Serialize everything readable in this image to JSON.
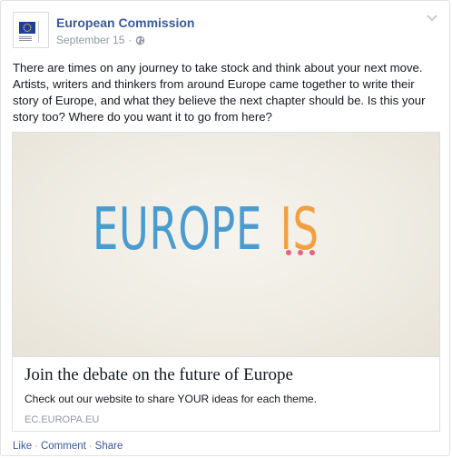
{
  "post": {
    "page_name": "European Commission",
    "date": "September 15",
    "meta_separator": "·",
    "privacy_icon": "globe-icon",
    "menu_icon": "chevron-down-icon",
    "text": "There are times on any journey to take stock and think about your next move. Artists, writers and thinkers from around Europe came together to write their story of Europe, and what they believe the next chapter should be. Is this your story too? Where do you want it to go from here?"
  },
  "card": {
    "image_text_main": "EUROPE",
    "image_text_accent": "IS",
    "title": "Join the debate on the future of Europe",
    "description": "Check out our website to share YOUR ideas for each theme.",
    "domain": "EC.EUROPA.EU"
  },
  "actions": {
    "like": "Like",
    "comment": "Comment",
    "share": "Share",
    "separator": "·"
  },
  "colors": {
    "link_blue": "#3b5998",
    "meta_gray": "#9197a3",
    "europe_blue": "#4a9bcf",
    "is_orange": "#f0a043",
    "dots_pink": "#e4657c"
  }
}
